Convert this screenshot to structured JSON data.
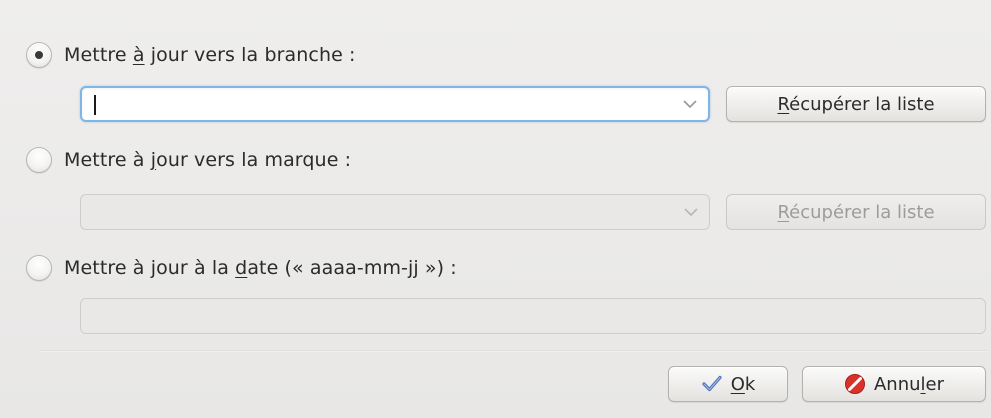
{
  "options": {
    "branch": {
      "label_before": "Mettre ",
      "label_accel": "à",
      "label_after": " jour vers la branche  :",
      "checked": true,
      "input_value": "",
      "fetch_button": {
        "accel": "R",
        "rest": "écupérer la liste"
      }
    },
    "tag": {
      "label_before": "Mettre à ",
      "label_accel": "j",
      "label_after": "our vers la marque  :",
      "checked": false,
      "input_value": "",
      "fetch_button": {
        "accel": "R",
        "rest": "écupérer la liste"
      }
    },
    "date": {
      "label_before": "Mettre à jour à la ",
      "label_accel": "d",
      "label_after": "ate  («  aaaa-mm-jj  »)  :",
      "checked": false,
      "input_value": ""
    }
  },
  "buttons": {
    "ok": {
      "accel": "O",
      "rest": "k",
      "icon": "checkmark-icon",
      "icon_color": "#4a6fb5"
    },
    "cancel": {
      "before": "Annu",
      "accel": "l",
      "after": "er",
      "icon": "cancel-icon",
      "icon_color": "#d9322b"
    }
  },
  "colors": {
    "focus_border": "#7fb6e6"
  }
}
